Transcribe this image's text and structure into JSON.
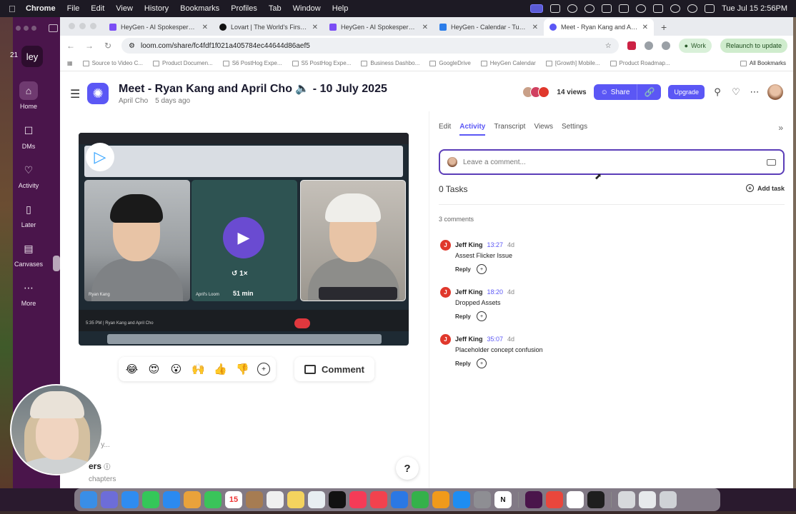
{
  "menubar": {
    "app": "Chrome",
    "items": [
      "File",
      "Edit",
      "View",
      "History",
      "Bookmarks",
      "Profiles",
      "Tab",
      "Window",
      "Help"
    ],
    "clock": "Tue Jul 15  2:56PM"
  },
  "slack": {
    "workspace": "ley",
    "badge": "21",
    "nav": [
      {
        "label": "Home",
        "icon": "home-icon"
      },
      {
        "label": "DMs",
        "icon": "dm-icon"
      },
      {
        "label": "Activity",
        "icon": "bell-icon"
      },
      {
        "label": "Later",
        "icon": "bookmark-icon"
      },
      {
        "label": "Canvases",
        "icon": "canvas-icon"
      },
      {
        "label": "More",
        "icon": "more-icon"
      }
    ]
  },
  "tabs": [
    {
      "title": "HeyGen - AI Spokesperson V",
      "color": "#7b4df5"
    },
    {
      "title": "Lovart | The World's First De",
      "color": "#111111"
    },
    {
      "title": "HeyGen - AI Spokesperson V",
      "color": "#7b4df5"
    },
    {
      "title": "HeyGen - Calendar - Tuesda",
      "color": "#2b7de9"
    },
    {
      "title": "Meet - Ryan Kang and April C",
      "color": "#5b57f5",
      "active": true
    }
  ],
  "toolbar": {
    "url": "loom.com/share/fc4fdf1f021a405784ec44644d86aef5",
    "profile": "Work",
    "relaunch": "Relaunch to update"
  },
  "bookmarks": [
    "Source to Video C...",
    "Product Documen...",
    "S6 PostHog Expe...",
    "S5 PostHog Expe...",
    "Business Dashbo...",
    "GoogleDrive",
    "HeyGen Calendar",
    "[Growth] Mobile...",
    "Product Roadmap..."
  ],
  "bookmarks_all": "All Bookmarks",
  "loom": {
    "title": "Meet - Ryan Kang and April Cho 🔈 - 10 July 2025",
    "author": "April Cho",
    "age": "5 days ago",
    "views": "14 views",
    "share": "Share",
    "upgrade": "Upgrade",
    "video": {
      "speed": "1×",
      "duration": "51 min",
      "tile_a": "Ryan Kang",
      "tile_b": "April's Loom",
      "footer": "5:35 PM  |  Ryan Kang and April Cho"
    },
    "reactions": [
      "😂",
      "😍",
      "😮",
      "🙌",
      "👍",
      "👎"
    ],
    "comment_btn": "Comment",
    "summary_title": "ary",
    "summary_sub": "mary...",
    "chapters_title": "ers",
    "chapters_sub": "chapters",
    "help": "?"
  },
  "panel": {
    "tabs": [
      "Edit",
      "Activity",
      "Transcript",
      "Views",
      "Settings"
    ],
    "active_tab": "Activity",
    "placeholder": "Leave a comment...",
    "tasks": "0 Tasks",
    "add_task": "Add task",
    "comment_count": "3 comments",
    "comments": [
      {
        "initial": "J",
        "name": "Jeff King",
        "ts": "13:27",
        "age": "4d",
        "body": "Assest Flicker Issue",
        "reply": "Reply"
      },
      {
        "initial": "J",
        "name": "Jeff King",
        "ts": "18:20",
        "age": "4d",
        "body": "Dropped Assets",
        "reply": "Reply"
      },
      {
        "initial": "J",
        "name": "Jeff King",
        "ts": "35:07",
        "age": "4d",
        "body": "Placeholder concept confusion",
        "reply": "Reply"
      }
    ]
  },
  "dock": {
    "calendar_day": "15",
    "calendar_month": "JUL"
  }
}
